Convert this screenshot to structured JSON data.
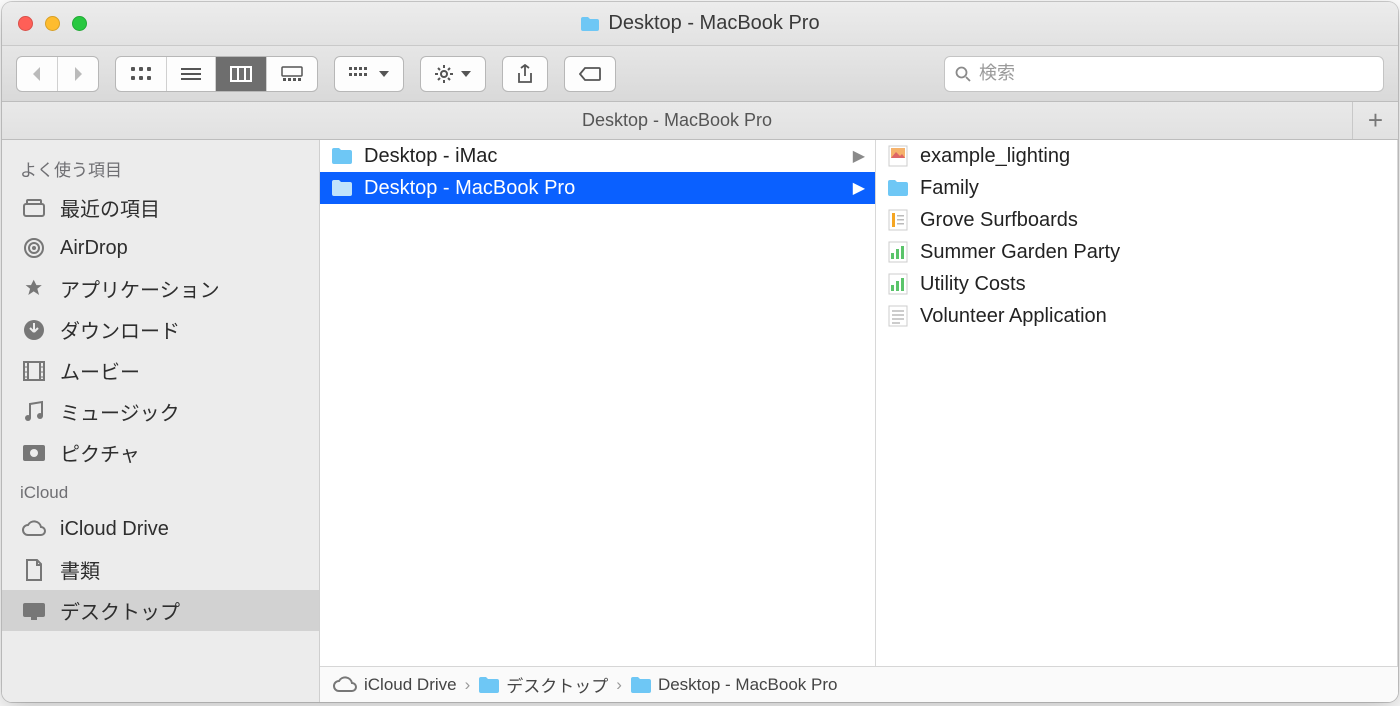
{
  "window": {
    "title": "Desktop - MacBook Pro",
    "tab_title": "Desktop - MacBook Pro"
  },
  "toolbar": {
    "back_disabled": true,
    "forward_disabled": true,
    "view_active": "columns",
    "search_placeholder": "検索"
  },
  "sidebar": {
    "sections": [
      {
        "header": "よく使う項目",
        "items": [
          {
            "icon": "recent",
            "label": "最近の項目"
          },
          {
            "icon": "airdrop",
            "label": "AirDrop"
          },
          {
            "icon": "apps",
            "label": "アプリケーション"
          },
          {
            "icon": "download",
            "label": "ダウンロード"
          },
          {
            "icon": "movie",
            "label": "ムービー"
          },
          {
            "icon": "music",
            "label": "ミュージック"
          },
          {
            "icon": "picture",
            "label": "ピクチャ"
          }
        ]
      },
      {
        "header": "iCloud",
        "items": [
          {
            "icon": "cloud",
            "label": "iCloud Drive"
          },
          {
            "icon": "doc",
            "label": "書類"
          },
          {
            "icon": "desktop",
            "label": "デスクトップ",
            "selected": true
          }
        ]
      }
    ]
  },
  "columns": [
    {
      "items": [
        {
          "icon": "folder",
          "label": "Desktop - iMac",
          "has_children": true
        },
        {
          "icon": "folder",
          "label": "Desktop - MacBook Pro",
          "has_children": true,
          "selected": true
        }
      ]
    },
    {
      "items": [
        {
          "icon": "image",
          "label": "example_lighting"
        },
        {
          "icon": "folder",
          "label": "Family"
        },
        {
          "icon": "pages",
          "label": "Grove Surfboards"
        },
        {
          "icon": "numbers",
          "label": "Summer Garden Party"
        },
        {
          "icon": "numbers",
          "label": "Utility Costs"
        },
        {
          "icon": "text",
          "label": "Volunteer Application"
        }
      ]
    }
  ],
  "pathbar": [
    {
      "icon": "cloud",
      "label": "iCloud Drive"
    },
    {
      "icon": "folder",
      "label": "デスクトップ"
    },
    {
      "icon": "folder",
      "label": "Desktop - MacBook Pro"
    }
  ]
}
